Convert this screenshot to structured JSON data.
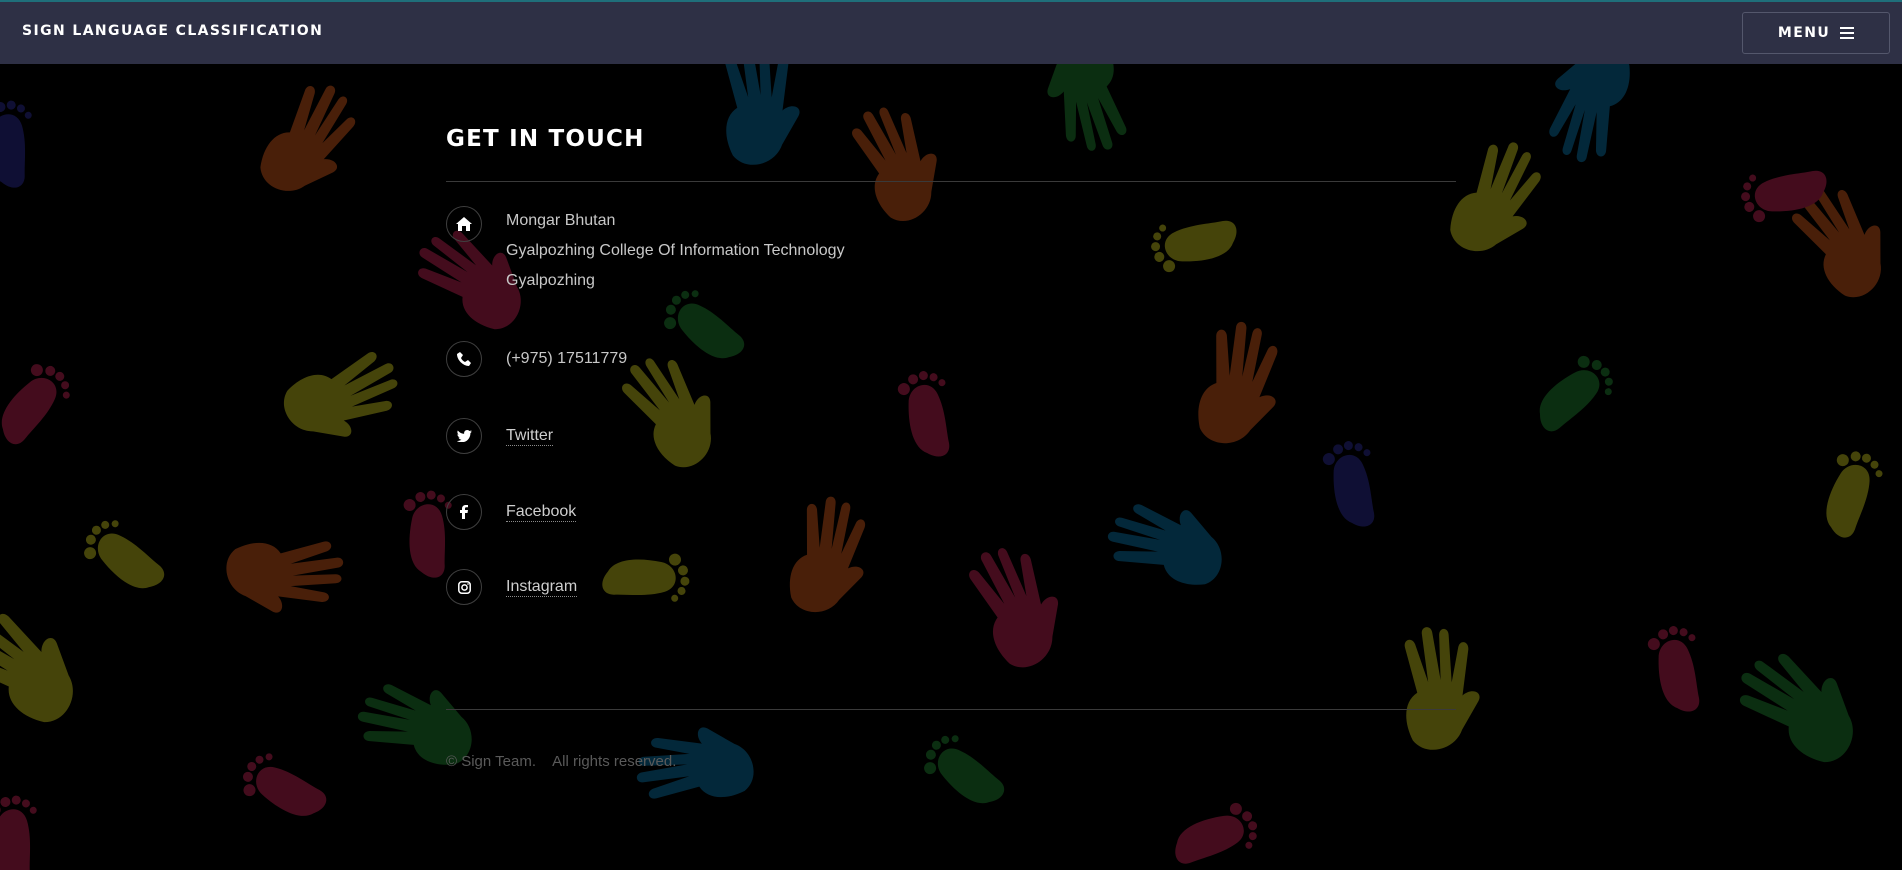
{
  "header": {
    "brand": "SIGN LANGUAGE CLASSIFICATION",
    "menu_label": "MENU"
  },
  "contact": {
    "title": "GET IN TOUCH",
    "address": [
      "Mongar Bhutan",
      "Gyalpozhing College Of Information Technology",
      "Gyalpozhing"
    ],
    "phone": "(+975) 17511779",
    "links": {
      "twitter": "Twitter",
      "facebook": "Facebook",
      "instagram": "Instagram"
    }
  },
  "footer": {
    "copyright": "© Sign Team.",
    "rights": "All rights reserved."
  },
  "icons": {
    "address": "home-icon",
    "phone": "phone-icon",
    "twitter": "twitter-icon",
    "facebook": "facebook-icon",
    "instagram": "instagram-icon",
    "menu": "hamburger-icon"
  },
  "colors": {
    "header_bg": "#2e3045",
    "page_bg": "#000000",
    "text": "#c8c8c8",
    "muted": "#5a5a5a",
    "handprints": [
      "#c1521a",
      "#0a6a9a",
      "#b8b51d",
      "#b5224f",
      "#1f7a2e",
      "#2a2a8a"
    ]
  }
}
